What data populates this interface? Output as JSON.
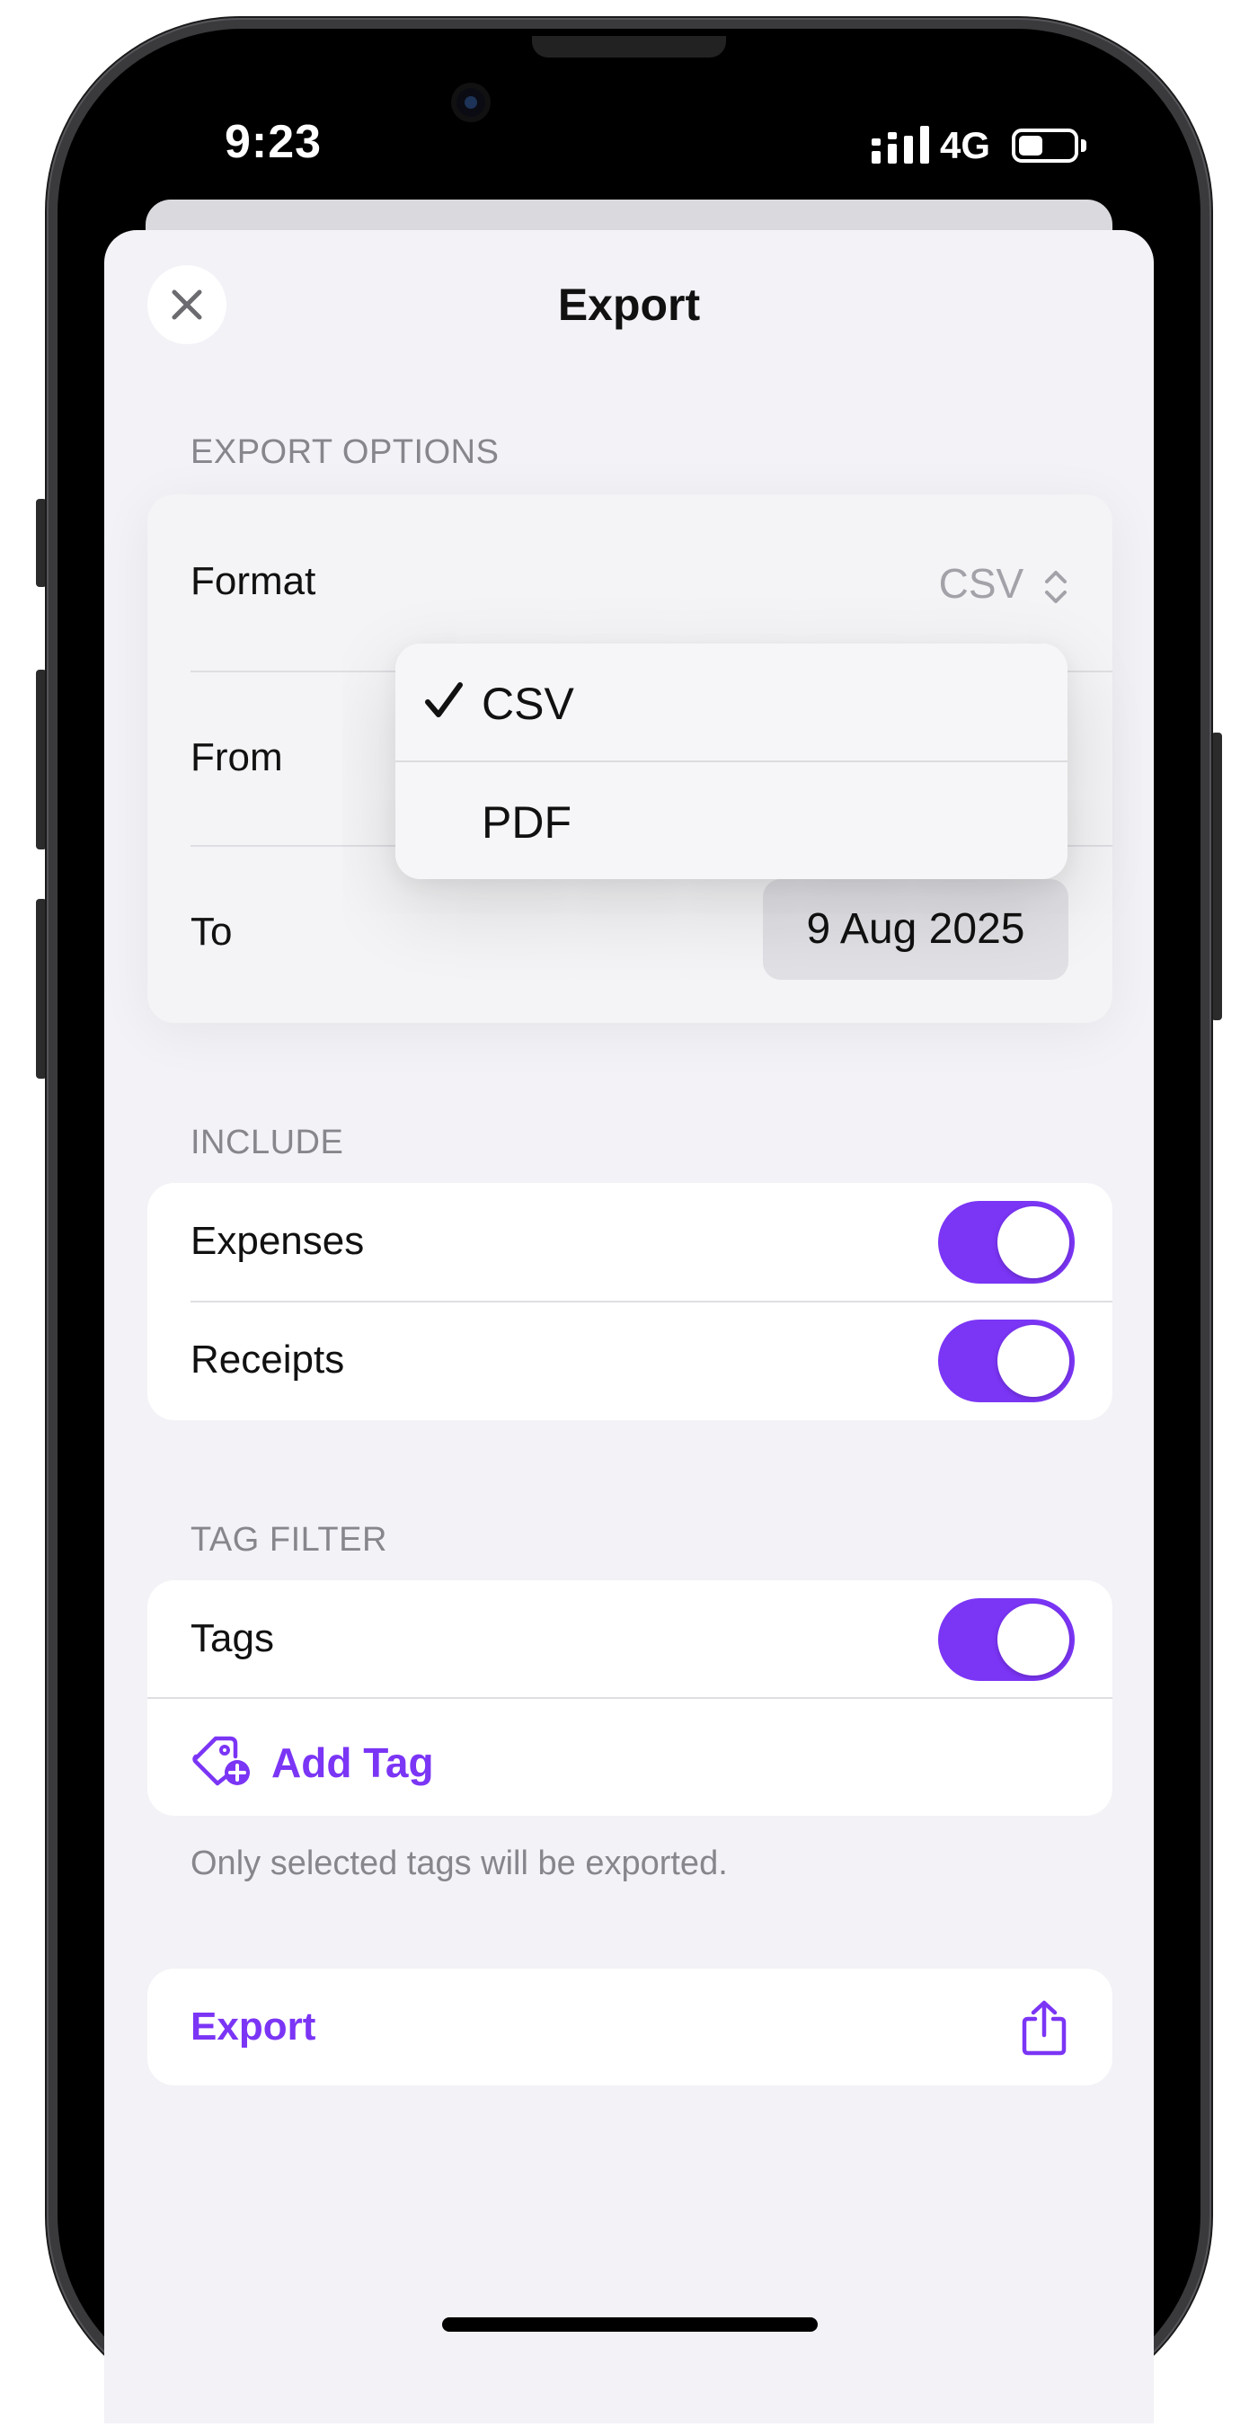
{
  "status_bar": {
    "time": "9:23",
    "network": "4G",
    "battery_level": 0.45
  },
  "header": {
    "title": "Export",
    "close_icon": "xmark-icon"
  },
  "export_options": {
    "section_label": "EXPORT OPTIONS",
    "format_label": "Format",
    "format_value": "CSV",
    "from_label": "From",
    "to_label": "To",
    "to_value": "9 Aug 2025"
  },
  "format_menu": {
    "options": [
      {
        "label": "CSV",
        "selected": true
      },
      {
        "label": "PDF",
        "selected": false
      }
    ]
  },
  "include": {
    "section_label": "INCLUDE",
    "items": [
      {
        "label": "Expenses",
        "on": true
      },
      {
        "label": "Receipts",
        "on": true
      }
    ]
  },
  "tag_filter": {
    "section_label": "TAG FILTER",
    "tags_label": "Tags",
    "tags_on": true,
    "add_tag_label": "Add Tag",
    "footnote": "Only selected tags will be exported."
  },
  "export_action": {
    "label": "Export",
    "icon": "share-icon"
  },
  "colors": {
    "accent": "#7B35F5",
    "background": "#F2F2F7",
    "secondary_text": "#86868C"
  }
}
